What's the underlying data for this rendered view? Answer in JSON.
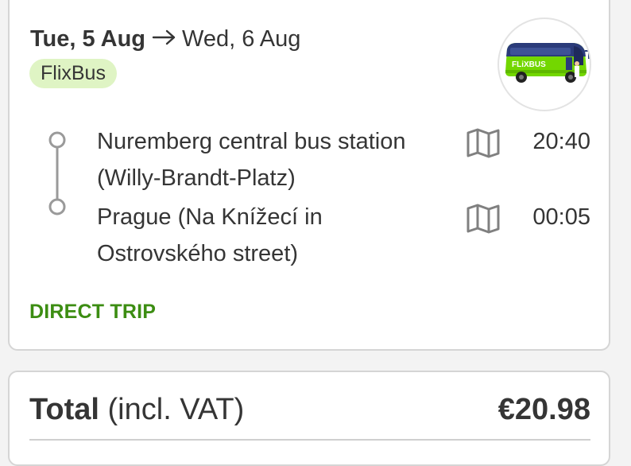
{
  "trip": {
    "departure_date": "Tue, 5 Aug",
    "arrival_date": "Wed, 6 Aug",
    "operator": "FlixBus",
    "logo_text": "FLiXBUS",
    "stops": [
      {
        "name": "Nuremberg central bus station (Willy-Brandt-Platz)",
        "time": "20:40",
        "icon": "map-icon"
      },
      {
        "name": "Prague (Na Knížecí in Ostrovského street)",
        "time": "00:05",
        "icon": "map-icon"
      }
    ],
    "trip_type": "DIRECT TRIP"
  },
  "total": {
    "label": "Total",
    "sub_label": "(incl. VAT)",
    "amount": "€20.98"
  },
  "colors": {
    "brand_green": "#73d700",
    "badge_bg": "#dff4c4",
    "direct_green": "#3c8d12",
    "bus_blue": "#2b3b7a"
  }
}
